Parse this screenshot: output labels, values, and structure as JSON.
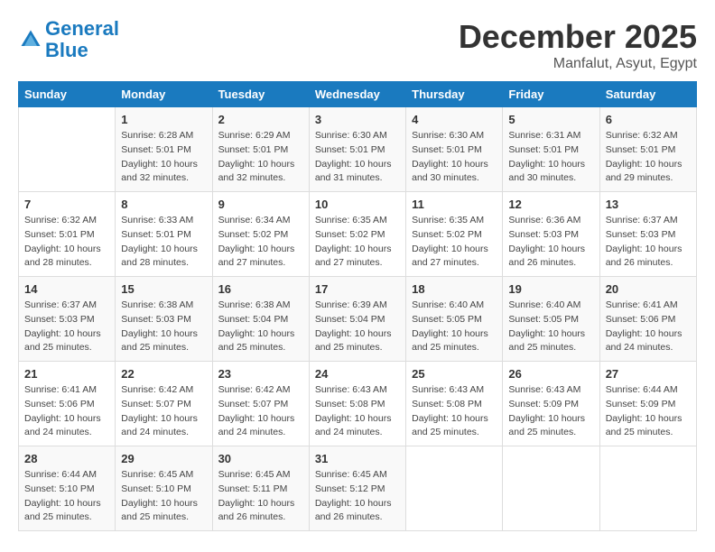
{
  "header": {
    "logo_line1": "General",
    "logo_line2": "Blue",
    "month": "December 2025",
    "location": "Manfalut, Asyut, Egypt"
  },
  "days_of_week": [
    "Sunday",
    "Monday",
    "Tuesday",
    "Wednesday",
    "Thursday",
    "Friday",
    "Saturday"
  ],
  "weeks": [
    [
      {
        "day": "",
        "info": ""
      },
      {
        "day": "1",
        "info": "Sunrise: 6:28 AM\nSunset: 5:01 PM\nDaylight: 10 hours and 32 minutes."
      },
      {
        "day": "2",
        "info": "Sunrise: 6:29 AM\nSunset: 5:01 PM\nDaylight: 10 hours and 32 minutes."
      },
      {
        "day": "3",
        "info": "Sunrise: 6:30 AM\nSunset: 5:01 PM\nDaylight: 10 hours and 31 minutes."
      },
      {
        "day": "4",
        "info": "Sunrise: 6:30 AM\nSunset: 5:01 PM\nDaylight: 10 hours and 30 minutes."
      },
      {
        "day": "5",
        "info": "Sunrise: 6:31 AM\nSunset: 5:01 PM\nDaylight: 10 hours and 30 minutes."
      },
      {
        "day": "6",
        "info": "Sunrise: 6:32 AM\nSunset: 5:01 PM\nDaylight: 10 hours and 29 minutes."
      }
    ],
    [
      {
        "day": "7",
        "info": "Sunrise: 6:32 AM\nSunset: 5:01 PM\nDaylight: 10 hours and 28 minutes."
      },
      {
        "day": "8",
        "info": "Sunrise: 6:33 AM\nSunset: 5:01 PM\nDaylight: 10 hours and 28 minutes."
      },
      {
        "day": "9",
        "info": "Sunrise: 6:34 AM\nSunset: 5:02 PM\nDaylight: 10 hours and 27 minutes."
      },
      {
        "day": "10",
        "info": "Sunrise: 6:35 AM\nSunset: 5:02 PM\nDaylight: 10 hours and 27 minutes."
      },
      {
        "day": "11",
        "info": "Sunrise: 6:35 AM\nSunset: 5:02 PM\nDaylight: 10 hours and 27 minutes."
      },
      {
        "day": "12",
        "info": "Sunrise: 6:36 AM\nSunset: 5:03 PM\nDaylight: 10 hours and 26 minutes."
      },
      {
        "day": "13",
        "info": "Sunrise: 6:37 AM\nSunset: 5:03 PM\nDaylight: 10 hours and 26 minutes."
      }
    ],
    [
      {
        "day": "14",
        "info": "Sunrise: 6:37 AM\nSunset: 5:03 PM\nDaylight: 10 hours and 25 minutes."
      },
      {
        "day": "15",
        "info": "Sunrise: 6:38 AM\nSunset: 5:03 PM\nDaylight: 10 hours and 25 minutes."
      },
      {
        "day": "16",
        "info": "Sunrise: 6:38 AM\nSunset: 5:04 PM\nDaylight: 10 hours and 25 minutes."
      },
      {
        "day": "17",
        "info": "Sunrise: 6:39 AM\nSunset: 5:04 PM\nDaylight: 10 hours and 25 minutes."
      },
      {
        "day": "18",
        "info": "Sunrise: 6:40 AM\nSunset: 5:05 PM\nDaylight: 10 hours and 25 minutes."
      },
      {
        "day": "19",
        "info": "Sunrise: 6:40 AM\nSunset: 5:05 PM\nDaylight: 10 hours and 25 minutes."
      },
      {
        "day": "20",
        "info": "Sunrise: 6:41 AM\nSunset: 5:06 PM\nDaylight: 10 hours and 24 minutes."
      }
    ],
    [
      {
        "day": "21",
        "info": "Sunrise: 6:41 AM\nSunset: 5:06 PM\nDaylight: 10 hours and 24 minutes."
      },
      {
        "day": "22",
        "info": "Sunrise: 6:42 AM\nSunset: 5:07 PM\nDaylight: 10 hours and 24 minutes."
      },
      {
        "day": "23",
        "info": "Sunrise: 6:42 AM\nSunset: 5:07 PM\nDaylight: 10 hours and 24 minutes."
      },
      {
        "day": "24",
        "info": "Sunrise: 6:43 AM\nSunset: 5:08 PM\nDaylight: 10 hours and 24 minutes."
      },
      {
        "day": "25",
        "info": "Sunrise: 6:43 AM\nSunset: 5:08 PM\nDaylight: 10 hours and 25 minutes."
      },
      {
        "day": "26",
        "info": "Sunrise: 6:43 AM\nSunset: 5:09 PM\nDaylight: 10 hours and 25 minutes."
      },
      {
        "day": "27",
        "info": "Sunrise: 6:44 AM\nSunset: 5:09 PM\nDaylight: 10 hours and 25 minutes."
      }
    ],
    [
      {
        "day": "28",
        "info": "Sunrise: 6:44 AM\nSunset: 5:10 PM\nDaylight: 10 hours and 25 minutes."
      },
      {
        "day": "29",
        "info": "Sunrise: 6:45 AM\nSunset: 5:10 PM\nDaylight: 10 hours and 25 minutes."
      },
      {
        "day": "30",
        "info": "Sunrise: 6:45 AM\nSunset: 5:11 PM\nDaylight: 10 hours and 26 minutes."
      },
      {
        "day": "31",
        "info": "Sunrise: 6:45 AM\nSunset: 5:12 PM\nDaylight: 10 hours and 26 minutes."
      },
      {
        "day": "",
        "info": ""
      },
      {
        "day": "",
        "info": ""
      },
      {
        "day": "",
        "info": ""
      }
    ]
  ]
}
